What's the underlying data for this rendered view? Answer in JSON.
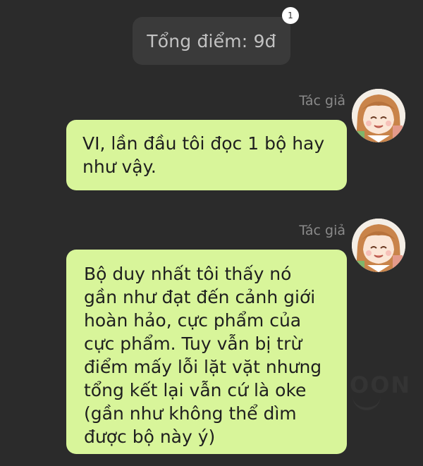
{
  "system_message": {
    "text": "Tổng điểm: 9đ",
    "badge": "1"
  },
  "messages": [
    {
      "sender": "Tác giả",
      "avatar": "author-avatar",
      "text": "VI, lần đầu tôi đọc 1 bộ hay như vậy."
    },
    {
      "sender": "Tác giả",
      "avatar": "author-avatar",
      "text": "Bộ duy nhất tôi thấy nó gần như đạt đến cảnh giới hoàn hảo, cực phẩm của cực phẩm. Tuy vẫn bị trừ điểm mấy lỗi lặt vặt nhưng tổng kết lại vẫn cứ là oke (gần như không thể dìm được bộ này ý)"
    }
  ],
  "watermark": "OON",
  "colors": {
    "background": "#2b2b2b",
    "bubble": "#d8f59a",
    "pill": "#3a3a3a"
  }
}
